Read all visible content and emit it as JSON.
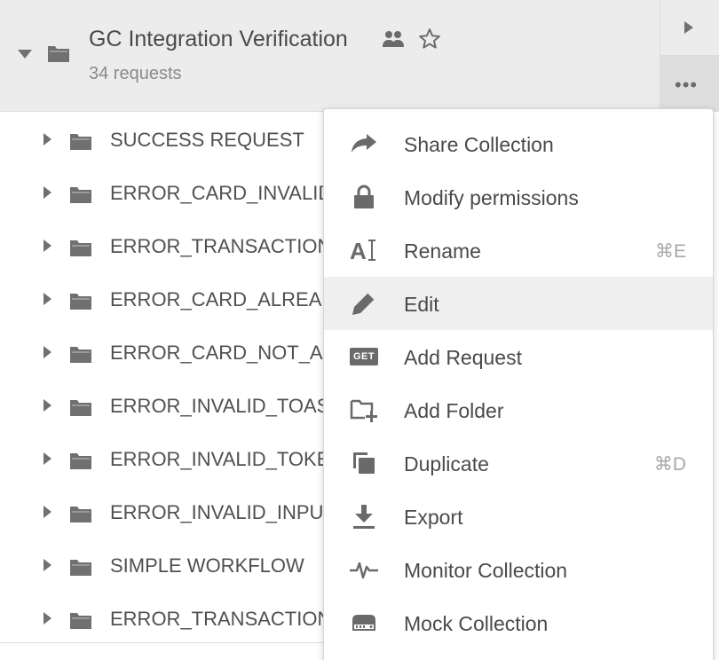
{
  "header": {
    "title": "GC Integration Verification",
    "subtitle": "34 requests",
    "icons": [
      "caret-down-icon",
      "folder-icon",
      "team-icon",
      "star-icon"
    ]
  },
  "right_column": {
    "run_icon": "play-icon",
    "more_icon": "more-icon",
    "more_label": "•••"
  },
  "folders": [
    {
      "label": "SUCCESS REQUEST"
    },
    {
      "label": "ERROR_CARD_INVALID"
    },
    {
      "label": "ERROR_TRANSACTION"
    },
    {
      "label": "ERROR_CARD_ALREAD"
    },
    {
      "label": "ERROR_CARD_NOT_AC"
    },
    {
      "label": "ERROR_INVALID_TOAS"
    },
    {
      "label": "ERROR_INVALID_TOKE"
    },
    {
      "label": "ERROR_INVALID_INPU"
    },
    {
      "label": "SIMPLE WORKFLOW"
    },
    {
      "label": "ERROR_TRANSACTION"
    }
  ],
  "menu": {
    "items": [
      {
        "label": "Share Collection",
        "icon": "share-icon",
        "shortcut": ""
      },
      {
        "label": "Modify permissions",
        "icon": "lock-icon",
        "shortcut": ""
      },
      {
        "label": "Rename",
        "icon": "rename-icon",
        "shortcut": "⌘E"
      },
      {
        "label": "Edit",
        "icon": "pencil-icon",
        "shortcut": "",
        "hovered": true
      },
      {
        "label": "Add Request",
        "icon": "get-request-icon",
        "shortcut": "",
        "badge": "GET"
      },
      {
        "label": "Add Folder",
        "icon": "add-folder-icon",
        "shortcut": ""
      },
      {
        "label": "Duplicate",
        "icon": "duplicate-icon",
        "shortcut": "⌘D"
      },
      {
        "label": "Export",
        "icon": "download-icon",
        "shortcut": ""
      },
      {
        "label": "Monitor Collection",
        "icon": "monitor-pulse-icon",
        "shortcut": ""
      },
      {
        "label": "Mock Collection",
        "icon": "mock-server-icon",
        "shortcut": ""
      }
    ]
  },
  "colors": {
    "header_bg": "#ececec",
    "icon_gray": "#707070",
    "menu_hover": "#efefef",
    "text": "#505050",
    "shortcut": "#a8a8a8"
  }
}
